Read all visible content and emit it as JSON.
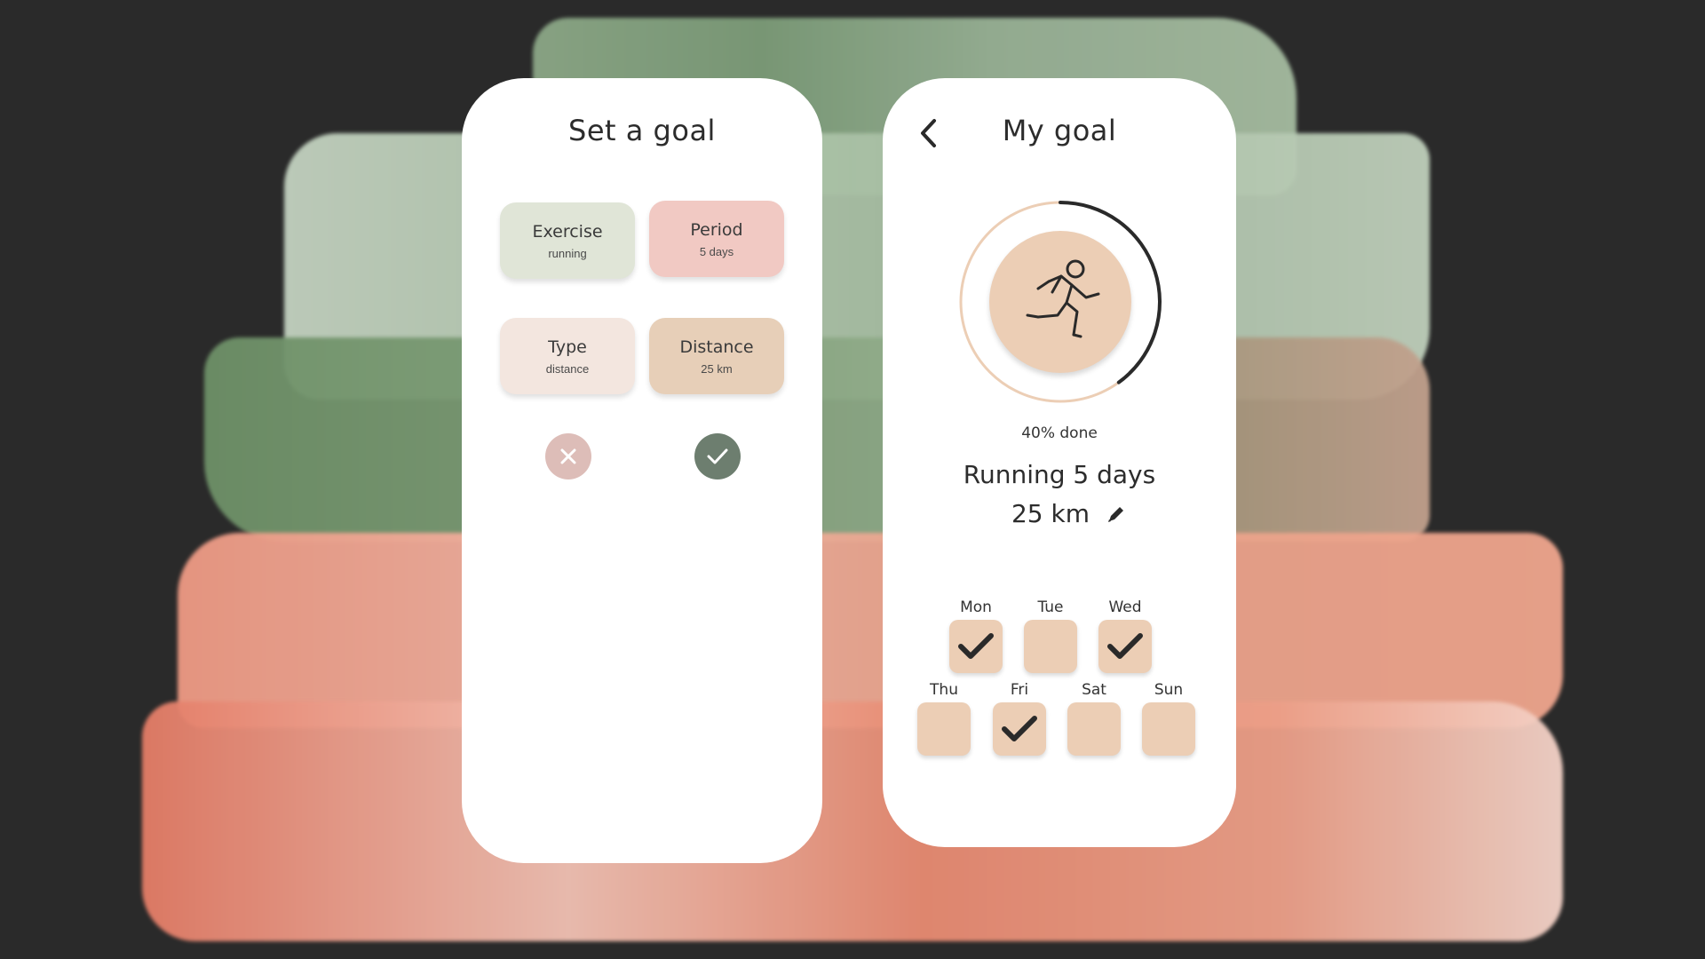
{
  "colors": {
    "background": "#2a2a2a",
    "card": "#ffffff",
    "tile_exercise": "#e0e5d7",
    "tile_period": "#f1c9c3",
    "tile_type": "#f3e6df",
    "tile_distance": "#e7cfb8",
    "cancel_button": "#ddbdb8",
    "confirm_button": "#6d7e6f",
    "day_box": "#ecceb5",
    "progress_track": "#ecceb5",
    "progress_fill": "#2a2a2a"
  },
  "set_goal": {
    "title": "Set a goal",
    "tiles": [
      {
        "label": "Exercise",
        "value": "running"
      },
      {
        "label": "Period",
        "value": "5 days"
      },
      {
        "label": "Type",
        "value": "distance"
      },
      {
        "label": "Distance",
        "value": "25 km"
      }
    ],
    "cancel_icon": "close-icon",
    "confirm_icon": "check-icon"
  },
  "my_goal": {
    "title": "My goal",
    "back_icon": "chevron-left-icon",
    "avatar_icon": "running-person-icon",
    "progress_fraction": 0.4,
    "done_text": "40% done",
    "summary": "Running 5 days",
    "distance": "25 km",
    "edit_icon": "pencil-icon",
    "days": [
      {
        "label": "Mon",
        "checked": true
      },
      {
        "label": "Tue",
        "checked": false
      },
      {
        "label": "Wed",
        "checked": true
      },
      {
        "label": "Thu",
        "checked": false
      },
      {
        "label": "Fri",
        "checked": true
      },
      {
        "label": "Sat",
        "checked": false
      },
      {
        "label": "Sun",
        "checked": false
      }
    ]
  }
}
